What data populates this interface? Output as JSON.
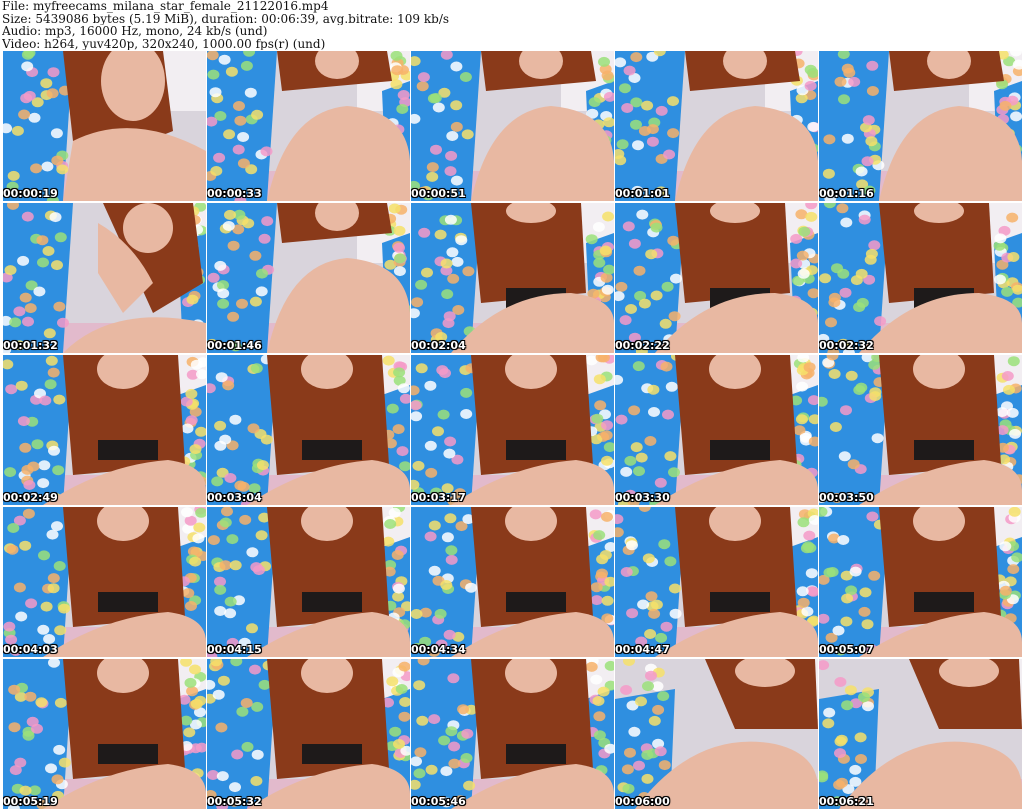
{
  "header": {
    "file": "File: myfreecams_milana_star_female_21122016.mp4",
    "size": "Size: 5439086 bytes (5.19 MiB), duration: 00:06:39, avg.bitrate: 109 kb/s",
    "audio": "Audio: mp3, 16000 Hz, mono, 24 kb/s (und)",
    "video": "Video: h264, yuv420p, 320x240, 1000.00 fps(r) (und)"
  },
  "colors": {
    "robe": "#2f8fe0",
    "hair": "#8a3a1a",
    "skin": "#e8b8a2",
    "background": "#ffffff"
  },
  "thumbnails": [
    {
      "timestamp": "00:00:19",
      "variant": "face-left"
    },
    {
      "timestamp": "00:00:33",
      "variant": "knee"
    },
    {
      "timestamp": "00:00:51",
      "variant": "knee"
    },
    {
      "timestamp": "00:01:01",
      "variant": "knee"
    },
    {
      "timestamp": "00:01:16",
      "variant": "knee"
    },
    {
      "timestamp": "00:01:32",
      "variant": "hand"
    },
    {
      "timestamp": "00:01:46",
      "variant": "knee"
    },
    {
      "timestamp": "00:02:04",
      "variant": "sitting"
    },
    {
      "timestamp": "00:02:22",
      "variant": "sitting"
    },
    {
      "timestamp": "00:02:32",
      "variant": "sitting"
    },
    {
      "timestamp": "00:02:49",
      "variant": "hair"
    },
    {
      "timestamp": "00:03:04",
      "variant": "hair"
    },
    {
      "timestamp": "00:03:17",
      "variant": "hair"
    },
    {
      "timestamp": "00:03:30",
      "variant": "hair"
    },
    {
      "timestamp": "00:03:50",
      "variant": "hair"
    },
    {
      "timestamp": "00:04:03",
      "variant": "hair"
    },
    {
      "timestamp": "00:04:15",
      "variant": "hair"
    },
    {
      "timestamp": "00:04:34",
      "variant": "hair"
    },
    {
      "timestamp": "00:04:47",
      "variant": "hair"
    },
    {
      "timestamp": "00:05:07",
      "variant": "hair"
    },
    {
      "timestamp": "00:05:19",
      "variant": "hair"
    },
    {
      "timestamp": "00:05:32",
      "variant": "hair"
    },
    {
      "timestamp": "00:05:46",
      "variant": "hair"
    },
    {
      "timestamp": "00:06:00",
      "variant": "close"
    },
    {
      "timestamp": "00:06:21",
      "variant": "close"
    }
  ]
}
